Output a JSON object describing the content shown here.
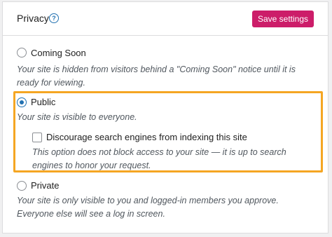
{
  "header": {
    "title": "Privacy",
    "help_icon": "question-circle-icon",
    "save_label": "Save settings"
  },
  "options": {
    "coming_soon": {
      "label": "Coming Soon",
      "checked": false,
      "description": "Your site is hidden from visitors behind a \"Coming Soon\" notice until it is ready for viewing."
    },
    "public": {
      "label": "Public",
      "checked": true,
      "description": "Your site is visible to everyone.",
      "discourage": {
        "label": "Discourage search engines from indexing this site",
        "checked": false,
        "description": "This option does not block access to your site — it is up to search engines to honor your request."
      }
    },
    "private": {
      "label": "Private",
      "checked": false,
      "description": "Your site is only visible to you and logged-in members you approve. Everyone else will see a log in screen."
    }
  },
  "colors": {
    "accent_button": "#cc1d69",
    "radio_selected": "#2271b1",
    "highlight_border": "#f5a623"
  }
}
